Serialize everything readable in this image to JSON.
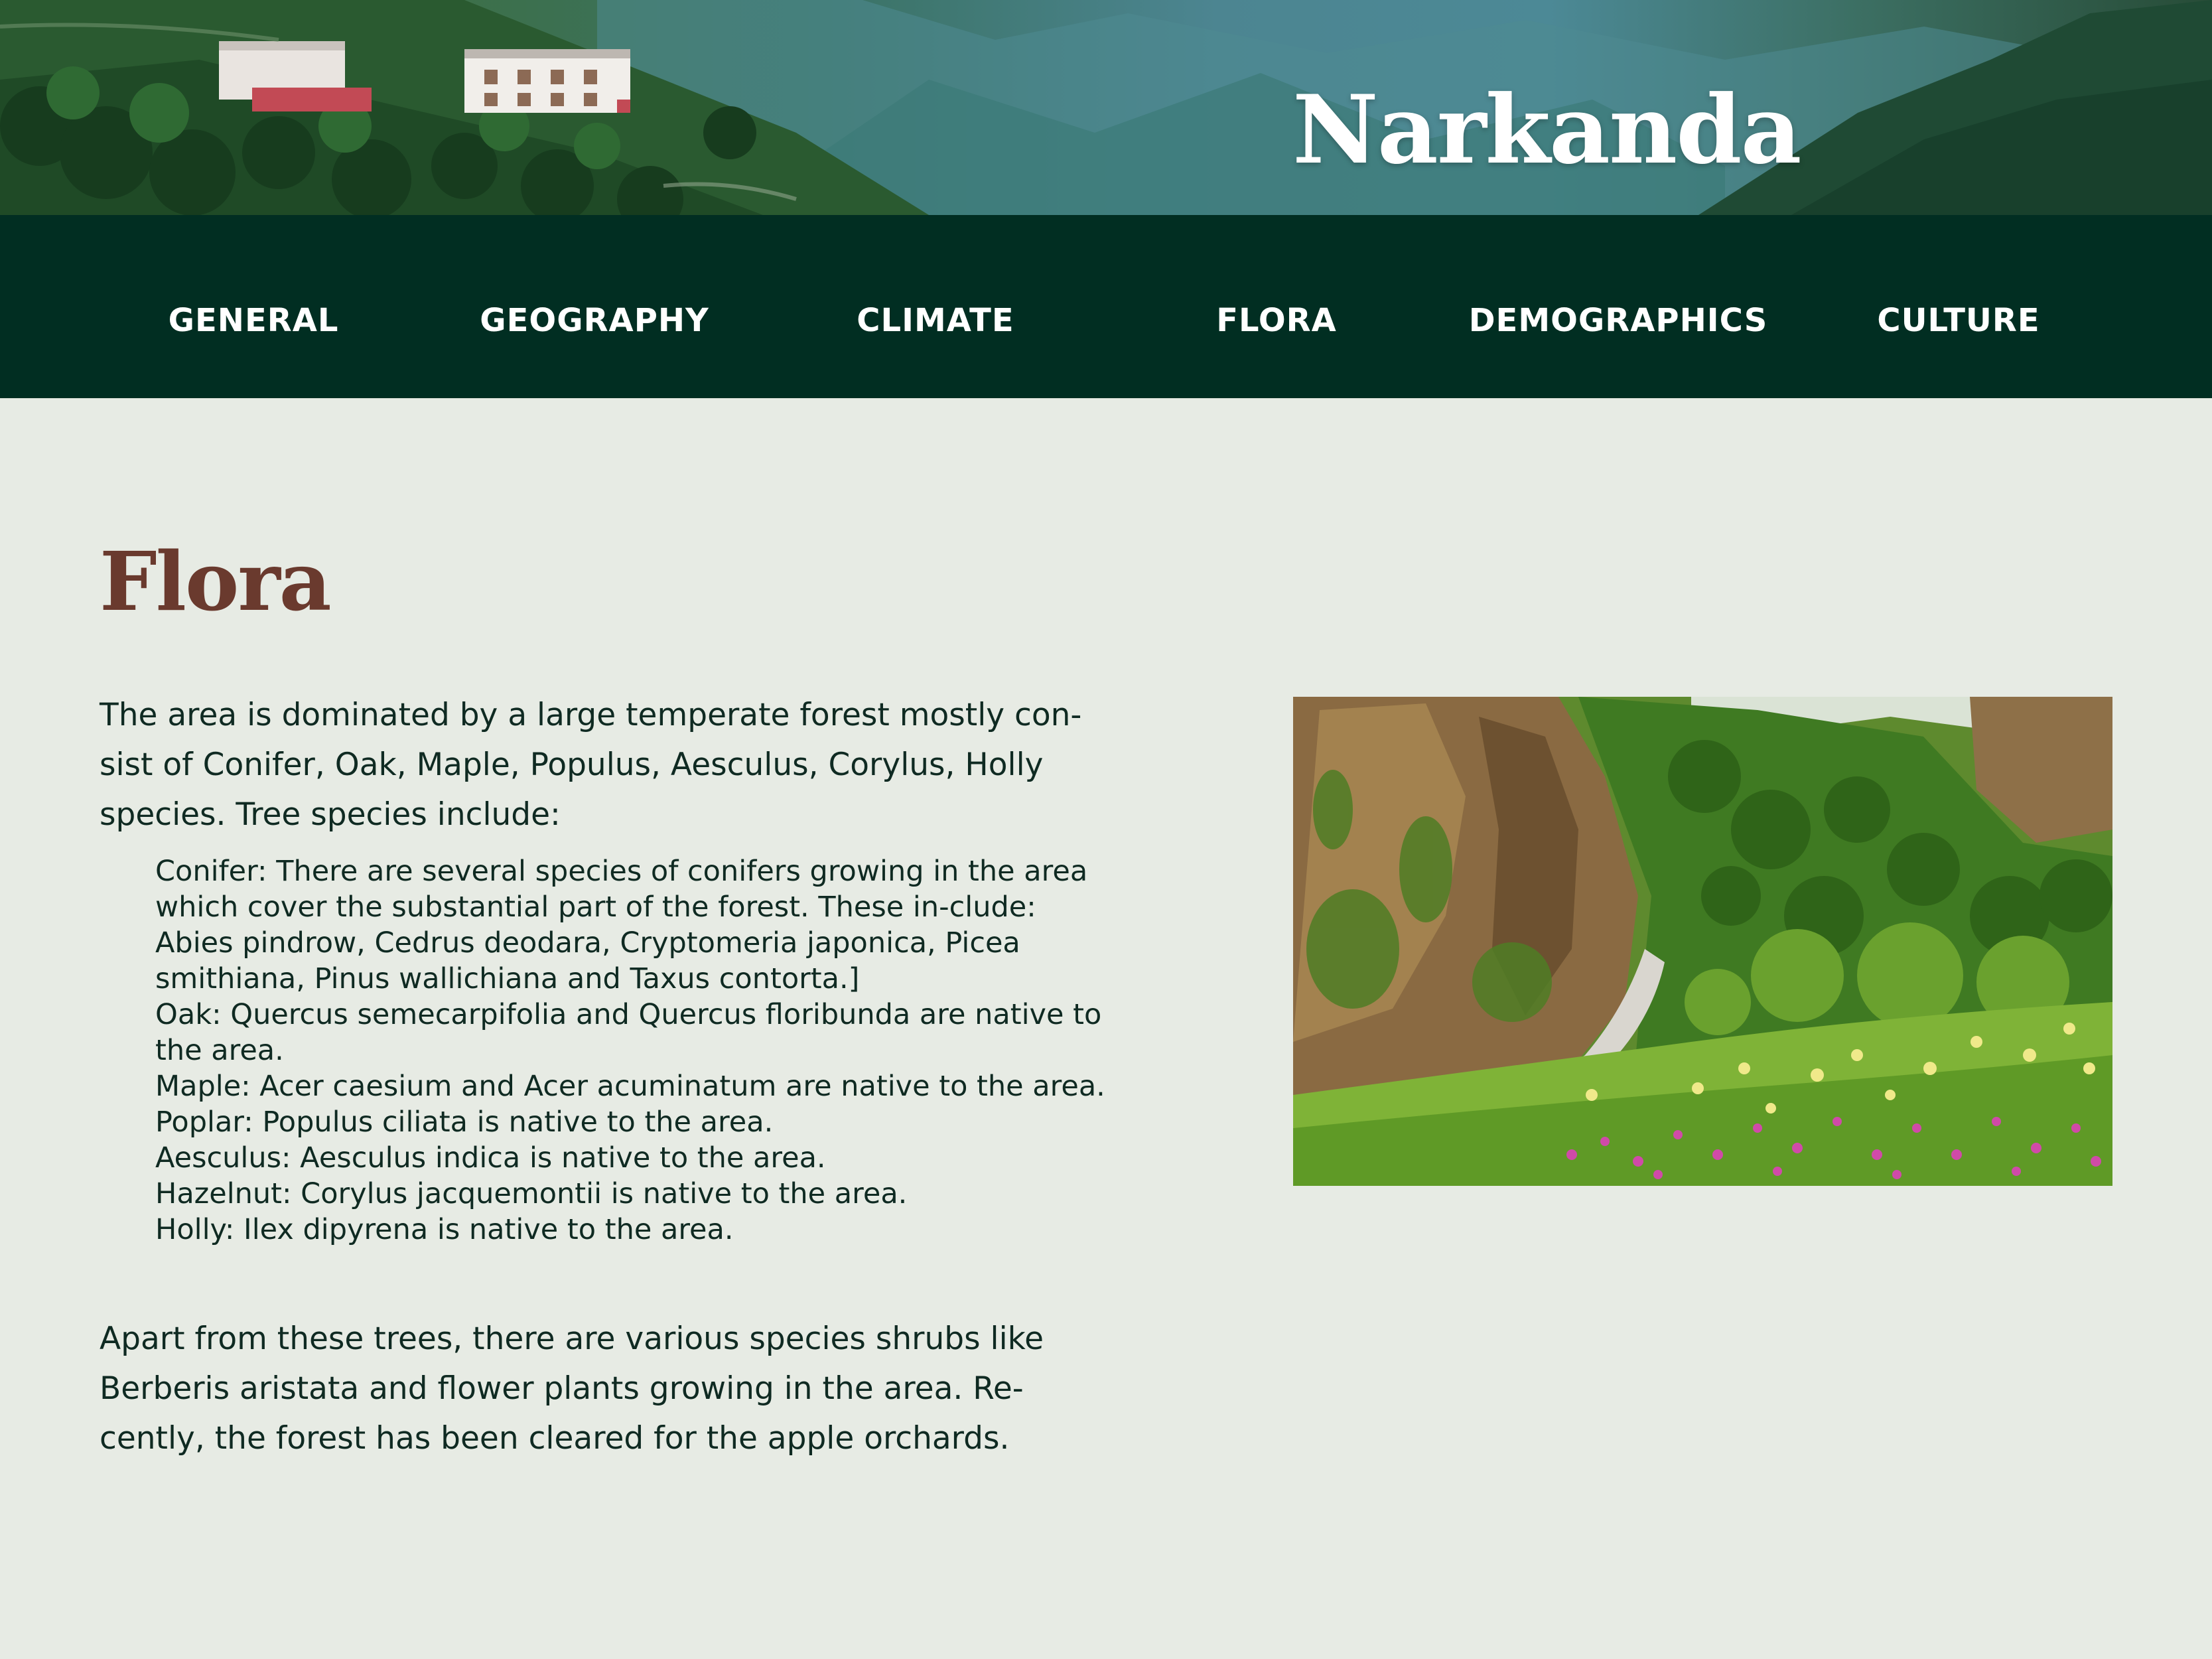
{
  "site": {
    "title": "Narkanda"
  },
  "nav": {
    "items": [
      {
        "label": "GENERAL"
      },
      {
        "label": "GEOGRAPHY"
      },
      {
        "label": "CLIMATE"
      },
      {
        "label": "FLORA"
      },
      {
        "label": "DEMOGRAPHICS"
      },
      {
        "label": "CULTURE"
      }
    ]
  },
  "main": {
    "heading": "Flora",
    "intro": "The area is dominated by a large temperate forest mostly con-sist of Conifer, Oak, Maple, Populus, Aesculus, Corylus, Holly species. Tree species include:",
    "species": [
      {
        "text": "Conifer: There are several species of conifers growing in the area which cover the substantial part of the forest. These in-clude: Abies pindrow, Cedrus deodara, Cryptomeria japonica, Picea smithiana, Pinus wallichiana and Taxus contorta.]"
      },
      {
        "text": "Oak: Quercus semecarpifolia and Quercus floribunda are native to the area."
      },
      {
        "text": "Maple: Acer caesium and Acer acuminatum are native to the area."
      },
      {
        "text": "Poplar: Populus ciliata is native to the area."
      },
      {
        "text": "Aesculus: Aesculus indica is native to the area."
      },
      {
        "text": "Hazelnut: Corylus jacquemontii is native to the area."
      },
      {
        "text": "Holly: Ilex dipyrena is native to the area."
      }
    ],
    "outro": "Apart from these trees, there are various species shrubs like Berberis aristata and flower plants growing in the area. Re-cently, the forest has been cleared for the apple orchards."
  },
  "colors": {
    "nav_bg": "#012e22",
    "page_bg": "#e7ebe4",
    "heading": "#6a3a2e",
    "body_text": "#0f2a22",
    "title_text": "#ffffff"
  }
}
